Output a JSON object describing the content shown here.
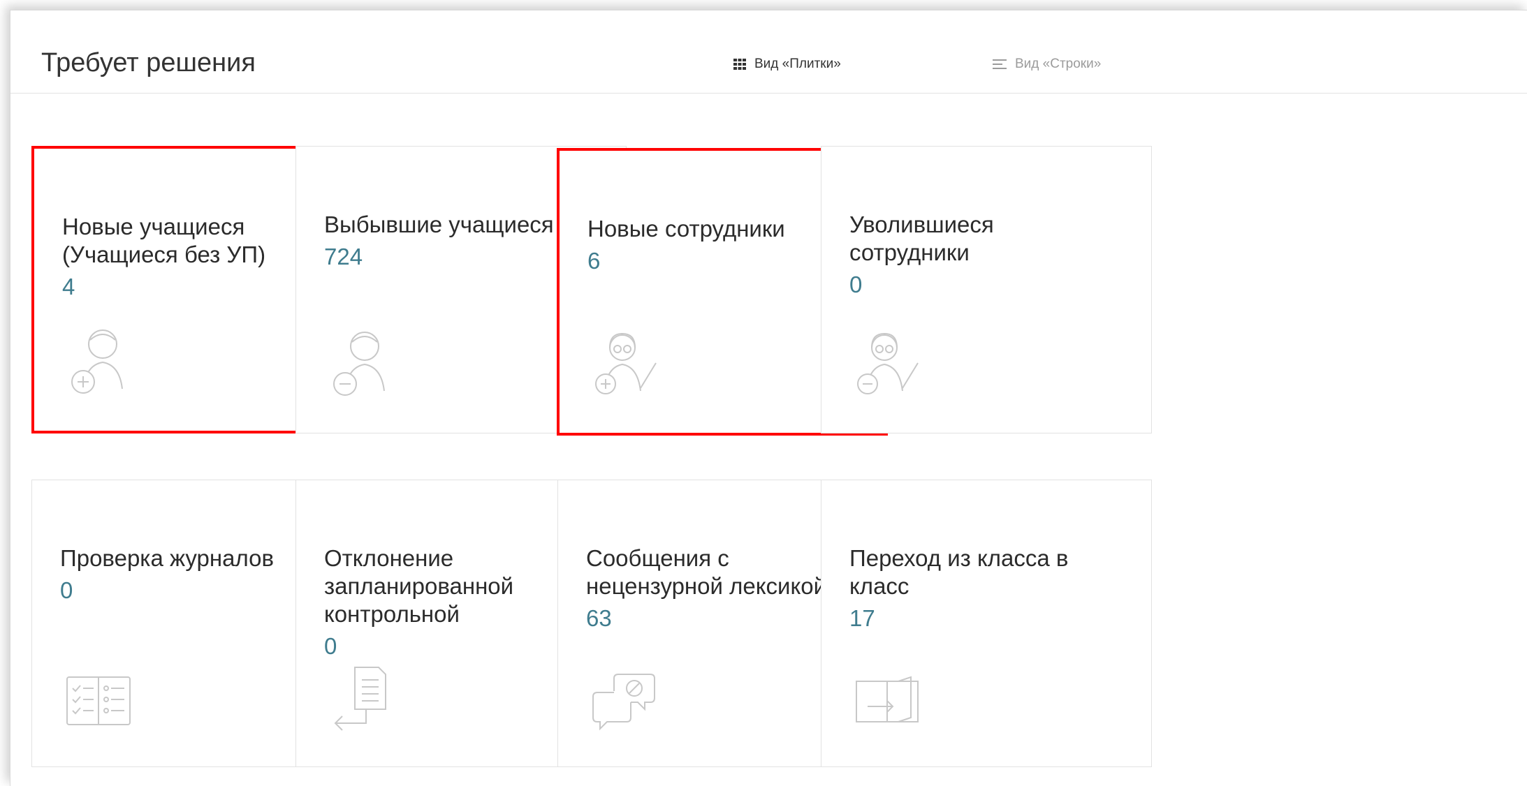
{
  "header": {
    "title": "Требует решения",
    "view_tiles_label": "Вид «Плитки»",
    "view_rows_label": "Вид «Строки»"
  },
  "tiles": [
    {
      "label": "Новые учащиеся\n(Учащиеся без УП)",
      "value": "4",
      "icon": "student-add-icon",
      "highlighted": true
    },
    {
      "label": "Выбывшие учащиеся",
      "value": "724",
      "icon": "student-remove-icon",
      "highlighted": false
    },
    {
      "label": "Новые сотрудники",
      "value": "6",
      "icon": "teacher-add-icon",
      "highlighted": true
    },
    {
      "label": "Уволившиеся\nсотрудники",
      "value": "0",
      "icon": "teacher-remove-icon",
      "highlighted": false
    },
    {
      "label": "Проверка журналов",
      "value": "0",
      "icon": "journal-check-icon",
      "highlighted": false
    },
    {
      "label": "Отклонение\nзапланированной\nконтрольной",
      "value": "0",
      "icon": "document-return-icon",
      "highlighted": false
    },
    {
      "label": "Сообщения с\nнецензурной лексикой",
      "value": "63",
      "icon": "chat-blocked-icon",
      "highlighted": false
    },
    {
      "label": "Переход из класса в\nкласс",
      "value": "17",
      "icon": "class-transfer-icon",
      "highlighted": false
    }
  ],
  "colors": {
    "value_color": "#3f7c8e",
    "highlight_border": "#ff0000",
    "icon_stroke": "#c8c8c8"
  }
}
